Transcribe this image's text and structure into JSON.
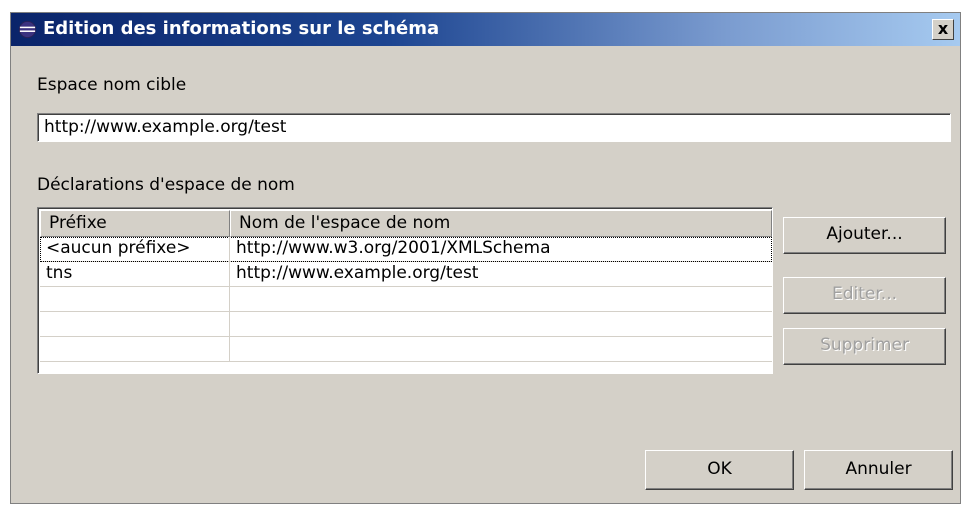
{
  "dialog": {
    "title": "Edition des informations sur le schéma",
    "close_label": "x"
  },
  "target_namespace": {
    "label": "Espace nom cible",
    "value": "http://www.example.org/test"
  },
  "declarations": {
    "label": "Déclarations d'espace de nom",
    "columns": [
      "Préfixe",
      "Nom de l'espace de nom"
    ],
    "rows": [
      {
        "prefix": "<aucun préfixe>",
        "namespace": "http://www.w3.org/2001/XMLSchema"
      },
      {
        "prefix": "tns",
        "namespace": "http://www.example.org/test"
      },
      {
        "prefix": "",
        "namespace": ""
      },
      {
        "prefix": "",
        "namespace": ""
      },
      {
        "prefix": "",
        "namespace": ""
      }
    ]
  },
  "buttons": {
    "add": "Ajouter...",
    "edit": "Editer...",
    "delete": "Supprimer",
    "ok": "OK",
    "cancel": "Annuler"
  },
  "colors": {
    "title_start": "#0a246a",
    "title_end": "#a6caf0",
    "dialog_bg": "#d4d0c8"
  },
  "icons": {
    "title": "eclipse-icon"
  }
}
